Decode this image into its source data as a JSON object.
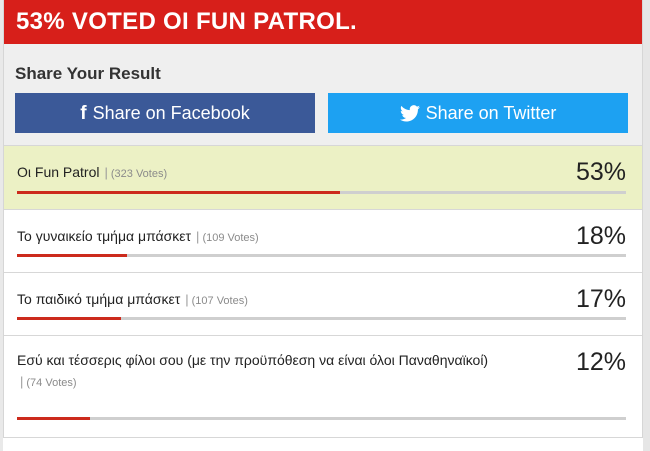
{
  "header": {
    "title": "53% VOTED OI FUN PATROL."
  },
  "share": {
    "title": "Share Your Result",
    "facebook_icon": "f",
    "facebook_label": "Share on Facebook",
    "twitter_label": "Share on Twitter",
    "facebook_color": "#3b5998",
    "twitter_color": "#1da1f2"
  },
  "results": [
    {
      "label": "Οι Fun Patrol",
      "votes": "(323 Votes)",
      "percent": "53%",
      "fraction": 0.53,
      "winner": true
    },
    {
      "label": "Το γυναικείο τμήμα μπάσκετ",
      "votes": "(109 Votes)",
      "percent": "18%",
      "fraction": 0.18,
      "winner": false
    },
    {
      "label": "Το παιδικό τμήμα μπάσκετ",
      "votes": "(107 Votes)",
      "percent": "17%",
      "fraction": 0.17,
      "winner": false
    },
    {
      "label": "Εσύ και τέσσερις φίλοι σου (με την προϋπόθεση να είναι όλοι Παναθηναϊκοί)",
      "votes": "(74 Votes)",
      "percent": "12%",
      "fraction": 0.12,
      "winner": false
    }
  ],
  "colors": {
    "header": "#d71f1a",
    "bar": "#cc2a1c",
    "winner_row": "#ecf1c5"
  }
}
